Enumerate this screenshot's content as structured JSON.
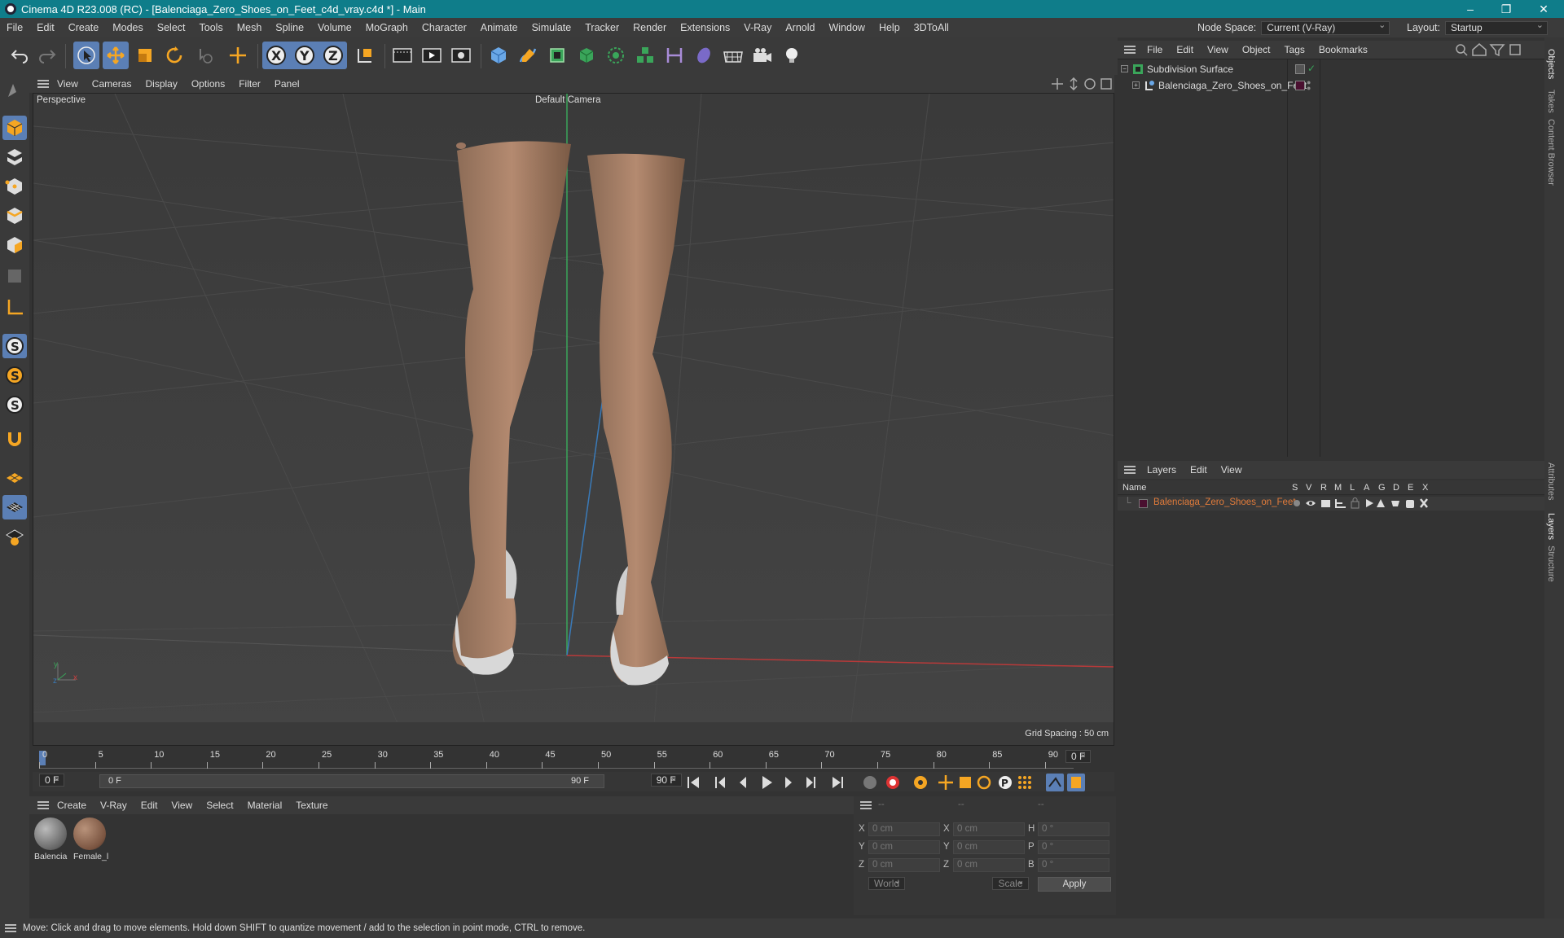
{
  "window": {
    "title": "Cinema 4D R23.008 (RC) - [Balenciaga_Zero_Shoes_on_Feet_c4d_vray.c4d *] - Main",
    "minimize": "–",
    "restore": "❐",
    "close": "✕"
  },
  "menubar": {
    "items": [
      "File",
      "Edit",
      "Create",
      "Modes",
      "Select",
      "Tools",
      "Mesh",
      "Spline",
      "Volume",
      "MoGraph",
      "Character",
      "Animate",
      "Simulate",
      "Tracker",
      "Render",
      "Extensions",
      "V-Ray",
      "Arnold",
      "Window",
      "Help",
      "3DToAll"
    ],
    "node_space_label": "Node Space:",
    "node_space_value": "Current (V-Ray)",
    "layout_label": "Layout:",
    "layout_value": "Startup"
  },
  "viewport": {
    "menu": [
      "View",
      "Cameras",
      "Display",
      "Options",
      "Filter",
      "Panel"
    ],
    "view_name": "Perspective",
    "camera": "Default Camera",
    "grid_spacing": "Grid Spacing : 50 cm",
    "axis_y": "y",
    "axis_x": "x",
    "axis_z": "z"
  },
  "timeline": {
    "ticks": [
      "0",
      "5",
      "10",
      "15",
      "20",
      "25",
      "30",
      "35",
      "40",
      "45",
      "50",
      "55",
      "60",
      "65",
      "70",
      "75",
      "80",
      "85",
      "90"
    ],
    "current_frame": "0 F",
    "start_field": "0 F",
    "range_start": "0 F",
    "range_end": "90 F",
    "end_field": "90 F"
  },
  "materials": {
    "menu": [
      "Create",
      "V-Ray",
      "Edit",
      "View",
      "Select",
      "Material",
      "Texture"
    ],
    "items": [
      {
        "name": "Balencia",
        "color": "#8a8a8a"
      },
      {
        "name": "Female_l",
        "color": "#8a6a55"
      }
    ]
  },
  "coordinates": {
    "header": [
      "--",
      "--",
      "--"
    ],
    "rows": [
      {
        "a": "X",
        "a_val": "0 cm",
        "b": "X",
        "b_val": "0 cm",
        "c": "H",
        "c_val": "0 °"
      },
      {
        "a": "Y",
        "a_val": "0 cm",
        "b": "Y",
        "b_val": "0 cm",
        "c": "P",
        "c_val": "0 °"
      },
      {
        "a": "Z",
        "a_val": "0 cm",
        "b": "Z",
        "b_val": "0 cm",
        "c": "B",
        "c_val": "0 °"
      }
    ],
    "space": "World",
    "mode": "Scale",
    "apply": "Apply"
  },
  "objects": {
    "menu": [
      "File",
      "Edit",
      "View",
      "Object",
      "Tags",
      "Bookmarks"
    ],
    "items": [
      {
        "name": "Subdivision Surface"
      },
      {
        "name": "Balenciaga_Zero_Shoes_on_Feet"
      }
    ]
  },
  "layers": {
    "menu": [
      "Layers",
      "Edit",
      "View"
    ],
    "columns": [
      "Name",
      "S",
      "V",
      "R",
      "M",
      "L",
      "A",
      "G",
      "D",
      "E",
      "X"
    ],
    "rows": [
      {
        "name": "Balenciaga_Zero_Shoes_on_Feet",
        "color": "#e07b3a"
      }
    ]
  },
  "side_tabs": [
    "Objects",
    "Takes",
    "Content Browser",
    "Attributes",
    "Layers",
    "Structure"
  ],
  "status": "Move: Click and drag to move elements. Hold down SHIFT to quantize movement / add to the selection in point mode, CTRL to remove."
}
